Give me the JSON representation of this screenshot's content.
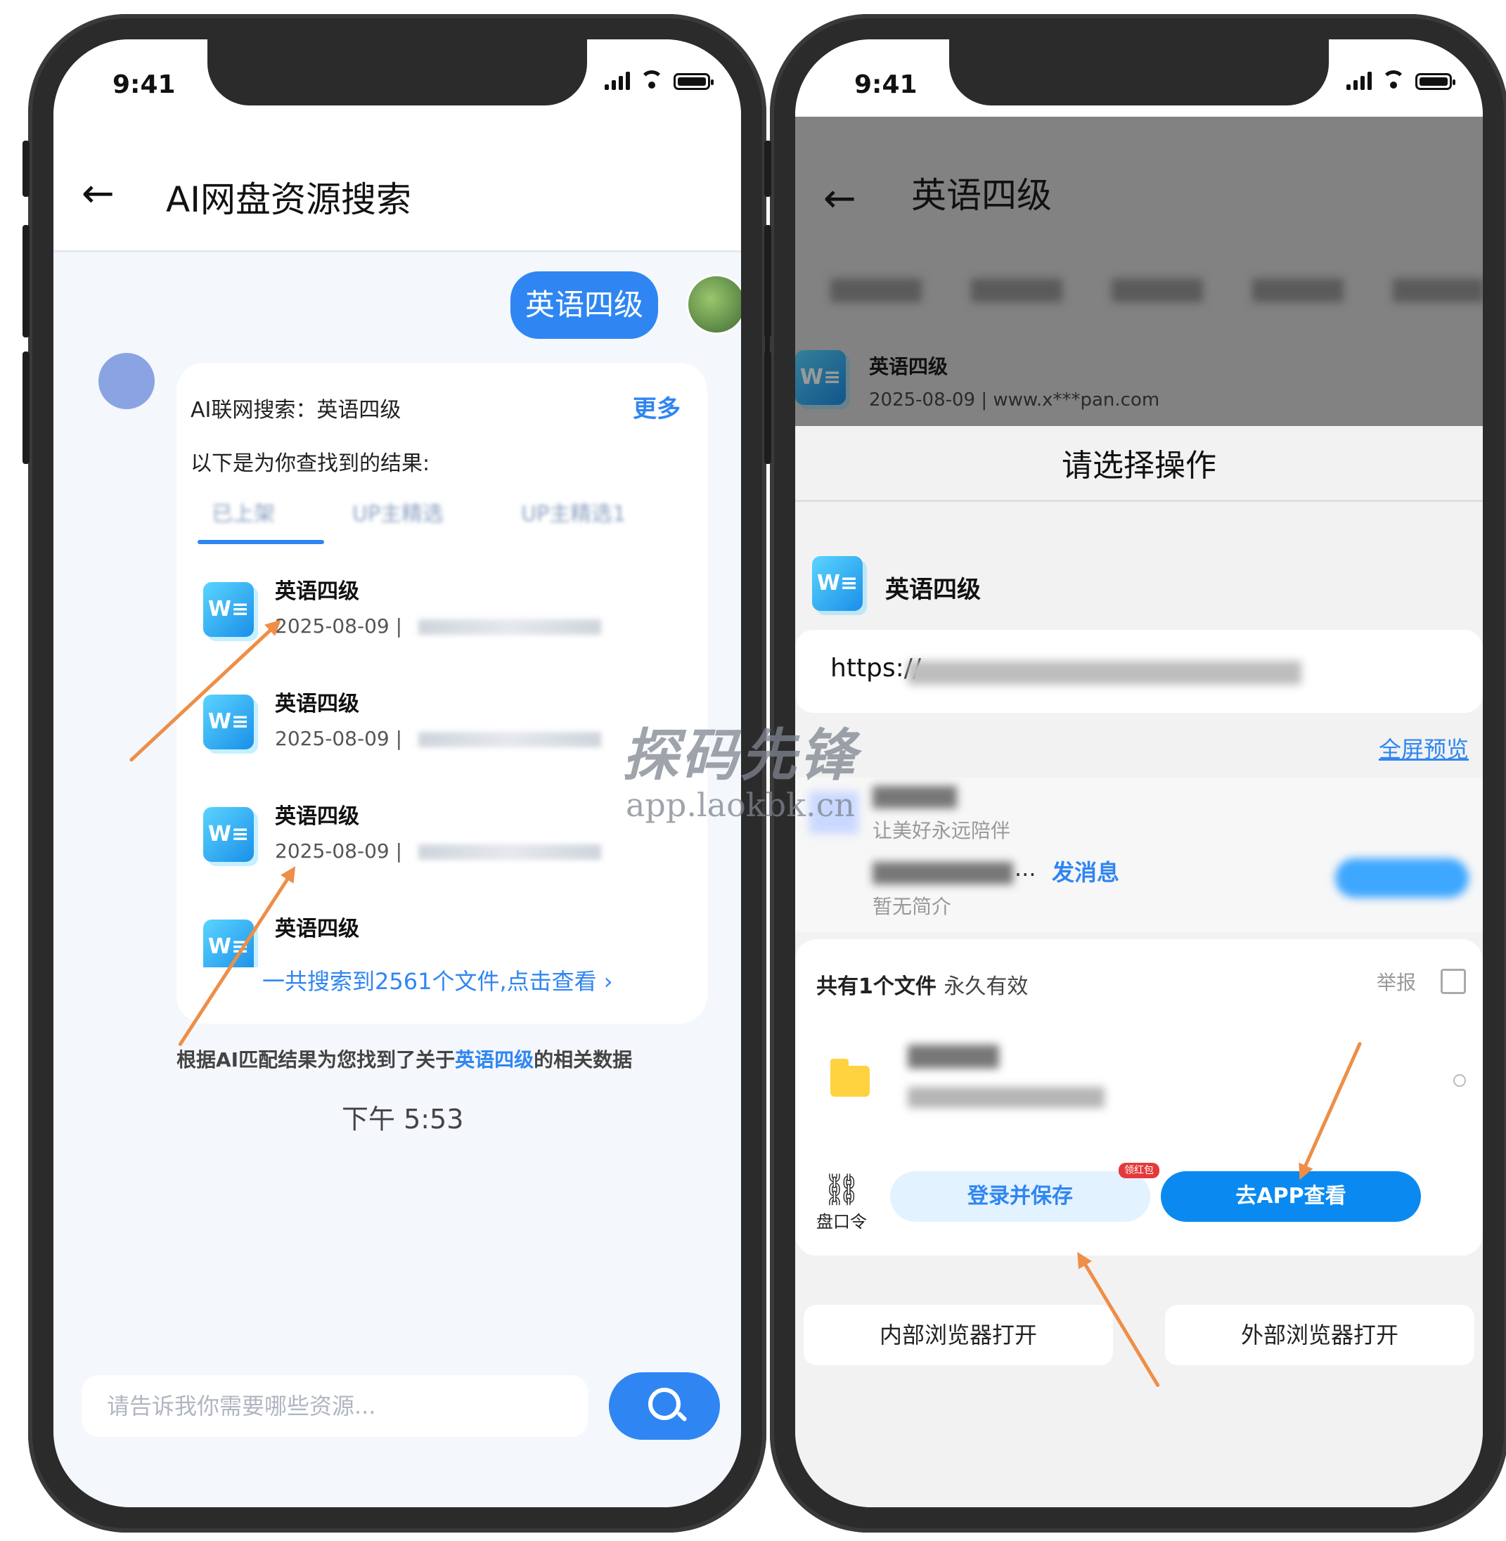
{
  "status": {
    "time": "9:41"
  },
  "left": {
    "title": "AI网盘资源搜索",
    "query": "英语四级",
    "card": {
      "search_line": "AI联网搜索：英语四级",
      "more": "更多",
      "intro": "以下是为你查找到的结果:",
      "tabs": [
        "已上架",
        "UP主精选",
        "UP主精选1"
      ],
      "results": [
        {
          "title": "英语四级",
          "date": "2025-08-09"
        },
        {
          "title": "英语四级",
          "date": "2025-08-09"
        },
        {
          "title": "英语四级",
          "date": "2025-08-09"
        },
        {
          "title": "英语四级",
          "date": ""
        }
      ],
      "count_link": "一共搜索到2561个文件,点击查看"
    },
    "summary_prefix": "根据AI匹配结果为您找到了关于",
    "summary_keyword": "英语四级",
    "summary_suffix": "的相关数据",
    "timestamp": "下午 5:53",
    "input_placeholder": "请告诉我你需要哪些资源..."
  },
  "right": {
    "title": "英语四级",
    "file": {
      "title": "英语四级",
      "date": "2025-08-09",
      "site": "www.x***pan.com"
    },
    "sheet": {
      "title": "请选择操作",
      "file_title": "英语四级",
      "url_prefix": "https://",
      "preview": "全屏预览",
      "slogan": "让美好永远陪伴",
      "ellipsis": "...",
      "message": "发消息",
      "no_msg": "暂无简介",
      "file_count": "共有1个文件",
      "valid": "永久有效",
      "report": "举报",
      "pan_code": "盘口令",
      "login_save": "登录并保存",
      "red_packet": "领红包",
      "open_app": "去APP查看",
      "inner_browser": "内部浏览器打开",
      "outer_browser": "外部浏览器打开"
    }
  },
  "watermark": {
    "title": "探码先锋",
    "site": "app.laokbk.cn"
  },
  "colors": {
    "accent": "#2f86f2",
    "arrow": "#ee8e47",
    "folder": "#ffd23f"
  }
}
